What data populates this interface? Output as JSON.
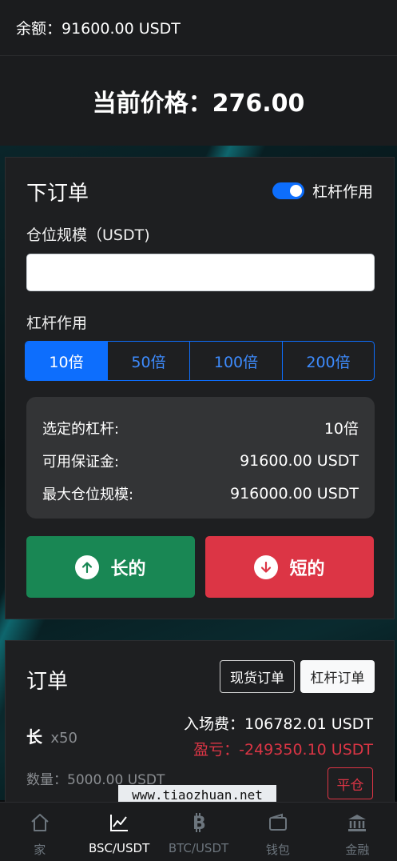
{
  "header": {
    "balance_text": "余额：91600.00 USDT",
    "price_text": "当前价格：276.00"
  },
  "order": {
    "title": "下订单",
    "leverage_toggle_label": "杠杆作用",
    "leverage_toggle_on": true,
    "size_label": "仓位规模（USDT)",
    "size_value": "",
    "leverage_label": "杠杆作用",
    "leverage_options": [
      "10倍",
      "50倍",
      "100倍",
      "200倍"
    ],
    "leverage_selected": "10倍",
    "info": {
      "selected_leverage_label": "选定的杠杆:",
      "selected_leverage_value": "10倍",
      "available_margin_label": "可用保证金:",
      "available_margin_value": "91600.00 USDT",
      "max_position_label": "最大仓位规模:",
      "max_position_value": "916000.00 USDT"
    },
    "long_label": "长的",
    "short_label": "短的"
  },
  "positions": {
    "title": "订单",
    "tab_spot": "现货订单",
    "tab_leverage": "杠杆订单",
    "item": {
      "direction": "长",
      "multiplier": "x50",
      "entry_fee": "入场费：106782.01 USDT",
      "pnl": "盈亏：-249350.10 USDT",
      "quantity": "数量：5000.00 USDT",
      "close_label": "平仓"
    }
  },
  "watermark": "www.tiaozhuan.net",
  "nav": {
    "items": [
      {
        "label": "家",
        "icon": "home-icon"
      },
      {
        "label": "BSC/USDT",
        "icon": "chart-line-icon"
      },
      {
        "label": "BTC/USDT",
        "icon": "bitcoin-icon"
      },
      {
        "label": "钱包",
        "icon": "wallet-icon"
      },
      {
        "label": "金融",
        "icon": "bank-icon"
      }
    ],
    "active": "BSC/USDT"
  },
  "colors": {
    "primary": "#0d6efd",
    "success": "#198754",
    "danger": "#dc3545",
    "card_bg": "#1e1f21",
    "info_bg": "#333436"
  }
}
